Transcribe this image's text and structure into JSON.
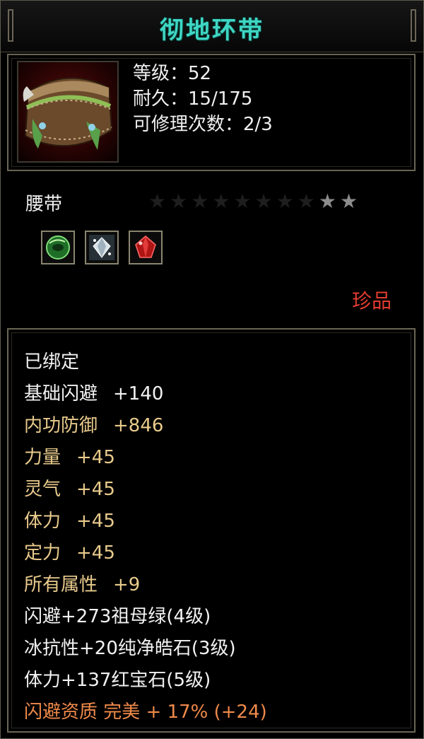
{
  "item": {
    "name": "彻地环带",
    "level_line": "等级：52",
    "durability_line": "耐久：15/175",
    "repair_line": "可修理次数：2/3",
    "type": "腰带",
    "stars_total": 10,
    "stars_lit": 2,
    "rarity": "珍品",
    "bound": "已绑定"
  },
  "gems": [
    {
      "icon": "jade-gem-icon",
      "color": "#2f9a3a"
    },
    {
      "icon": "diamond-gem-icon",
      "color": "#c9d6dc"
    },
    {
      "icon": "ruby-gem-icon",
      "color": "#c41c1c"
    }
  ],
  "attributes": [
    {
      "label": "基础闪避",
      "value": "+140",
      "color": "white"
    },
    {
      "label": "内功防御",
      "value": "+846",
      "color": "gold"
    },
    {
      "label": "力量",
      "value": "+45",
      "color": "gold"
    },
    {
      "label": "灵气",
      "value": "+45",
      "color": "gold"
    },
    {
      "label": "体力",
      "value": "+45",
      "color": "gold"
    },
    {
      "label": "定力",
      "value": "+45",
      "color": "gold"
    },
    {
      "label": "所有属性",
      "value": "+9",
      "color": "gold"
    }
  ],
  "gem_lines": [
    "闪避+273祖母绿(4级)",
    "冰抗性+20纯净皓石(3级)",
    "体力+137红宝石(5级)"
  ],
  "quality_line": "闪避资质 完美 + 17% (+24)",
  "colors": {
    "title": "#3fd7c4",
    "rarity": "#e23c30",
    "gold": "#e9cb8c",
    "orange": "#f08a4a"
  }
}
